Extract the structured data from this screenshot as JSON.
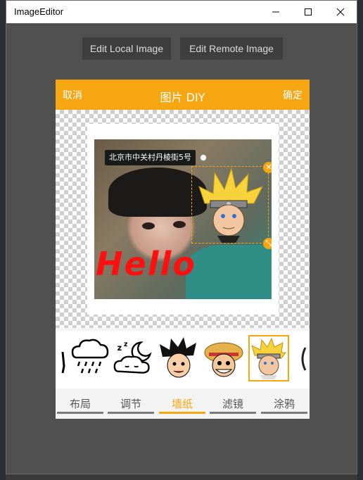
{
  "window": {
    "title": "ImageEditor"
  },
  "toolbar": {
    "edit_local": "Edit Local Image",
    "edit_remote": "Edit Remote Image"
  },
  "dialog": {
    "cancel": "取消",
    "title": "图片 DIY",
    "confirm": "确定",
    "location_label": "北京市中关村丹棱街5号",
    "text_overlay": "Hello"
  },
  "stickers": [
    {
      "name": "rain-cloud-sticker"
    },
    {
      "name": "sleeping-moon-cloud-sticker"
    },
    {
      "name": "goku-sticker"
    },
    {
      "name": "luffy-sticker"
    },
    {
      "name": "naruto-sticker",
      "selected": true
    }
  ],
  "tabs": [
    {
      "label": "布局",
      "active": false
    },
    {
      "label": "调节",
      "active": false
    },
    {
      "label": "墙纸",
      "active": true
    },
    {
      "label": "滤镜",
      "active": false
    },
    {
      "label": "涂鸦",
      "active": false
    }
  ],
  "colors": {
    "accent": "#f6a611",
    "window_bg": "#505050",
    "text_overlay": "#ff1010"
  }
}
